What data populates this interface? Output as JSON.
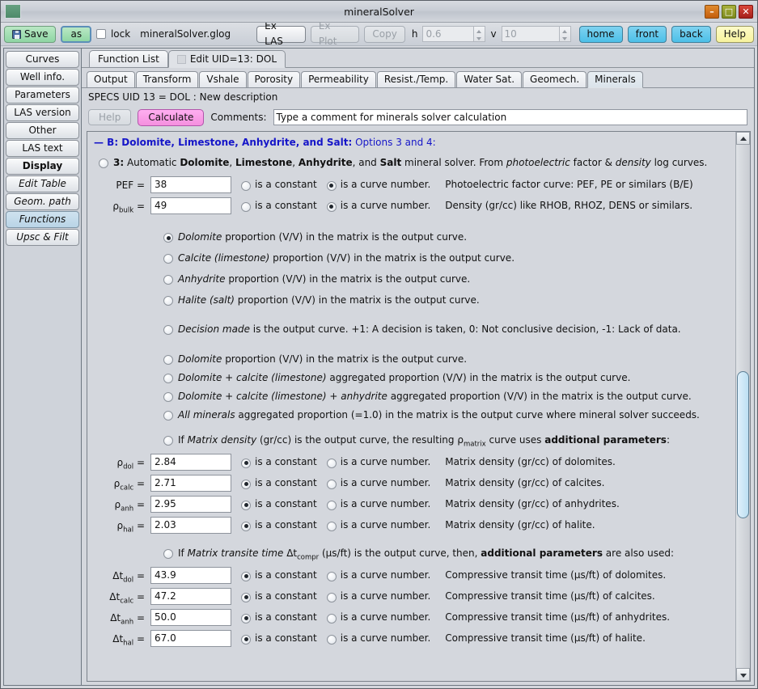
{
  "window": {
    "title": "mineralSolver",
    "icon": "app-icon",
    "buttons": {
      "minimize": "–",
      "maximize": "□",
      "close": "✕"
    }
  },
  "toolbar": {
    "save_label": "Save",
    "as_label": "as",
    "lock_label": "lock",
    "filename": "mineralSolver.glog",
    "ex_las_label": "Ex LAS",
    "ex_plot_label": "Ex Plot",
    "copy_label": "Copy",
    "h_label": "h",
    "h_value": "0.6",
    "v_label": "v",
    "v_value": "10",
    "home_label": "home",
    "front_label": "front",
    "back_label": "back",
    "help_label": "Help"
  },
  "sidebar": {
    "items": [
      {
        "label": "Curves",
        "style": "normal"
      },
      {
        "label": "Well info.",
        "style": "normal"
      },
      {
        "label": "Parameters",
        "style": "normal"
      },
      {
        "label": "LAS version",
        "style": "normal"
      },
      {
        "label": "Other",
        "style": "normal"
      },
      {
        "label": "LAS text",
        "style": "normal"
      },
      {
        "label": "Display",
        "style": "bold"
      },
      {
        "label": "Edit Table",
        "style": "italic"
      },
      {
        "label": "Geom. path",
        "style": "italic"
      },
      {
        "label": "Functions",
        "style": "italic-selected"
      },
      {
        "label": "Upsc & Filt",
        "style": "italic"
      }
    ]
  },
  "tabs_primary": [
    {
      "label": "Function List",
      "active": false
    },
    {
      "label": "Edit UID=13: DOL",
      "active": true
    }
  ],
  "tabs_secondary": [
    {
      "label": "Output",
      "active": false
    },
    {
      "label": "Transform",
      "active": false
    },
    {
      "label": "Vshale",
      "active": false
    },
    {
      "label": "Porosity",
      "active": false
    },
    {
      "label": "Permeability",
      "active": false
    },
    {
      "label": "Resist./Temp.",
      "active": false
    },
    {
      "label": "Water Sat.",
      "active": false
    },
    {
      "label": "Geomech.",
      "active": false
    },
    {
      "label": "Minerals",
      "active": true
    }
  ],
  "specs_line": "SPECS UID 13 = DOL : New description",
  "command_row": {
    "help_label": "Help",
    "calculate_label": "Calculate",
    "comments_label": "Comments:",
    "comments_value": "Type a comment for minerals solver calculation"
  },
  "section": {
    "heading_bold": "— B: Dolomite, Limestone, Anhydrite, and Salt:",
    "heading_thin": " Options 3 and 4:",
    "option3_selected": false,
    "option3_number": "3:",
    "option3_text_parts": [
      " Automatic ",
      "Dolomite",
      ", ",
      "Limestone",
      ", ",
      "Anhydrite",
      ", and ",
      "Salt",
      " mineral solver. From ",
      "photoelectric",
      " factor & ",
      "density",
      " log curves."
    ]
  },
  "inputs_top": [
    {
      "label": "PEF =",
      "value": "38",
      "constant_label": "is a constant",
      "constant_selected": false,
      "curve_label": "is a curve number.",
      "curve_selected": true,
      "description": "Photoelectric factor curve: PEF, PE or similars (B/E)"
    },
    {
      "label": "ρbulk =",
      "label_base": "ρ",
      "label_sub": "bulk",
      "value": "49",
      "constant_label": "is a constant",
      "constant_selected": false,
      "curve_label": "is a curve number.",
      "curve_selected": true,
      "description": "Density (gr/cc) like RHOB, RHOZ, DENS or similars."
    }
  ],
  "output_options": [
    {
      "selected": true,
      "italic": "Dolomite",
      "rest": " proportion (V/V) in the matrix is the output curve."
    },
    {
      "selected": false,
      "italic": "Calcite (limestone)",
      "rest": " proportion (V/V) in the matrix is the output curve."
    },
    {
      "selected": false,
      "italic": "Anhydrite",
      "rest": " proportion (V/V) in the matrix is the output curve."
    },
    {
      "selected": false,
      "italic": "Halite (salt)",
      "rest": " proportion (V/V) in the matrix is the output curve."
    }
  ],
  "decision_option": {
    "selected": false,
    "italic": "Decision made",
    "rest": " is the output curve. +1: A decision is taken, 0: Not conclusive decision, -1: Lack of data."
  },
  "aggregate_options": [
    {
      "selected": false,
      "italic": "Dolomite",
      "rest": " proportion (V/V) in the matrix is the output curve."
    },
    {
      "selected": false,
      "italic": "Dolomite + calcite (limestone)",
      "rest": " aggregated proportion (V/V) in the matrix is the output curve."
    },
    {
      "selected": false,
      "italic": "Dolomite + calcite (limestone) + anhydrite",
      "rest": " aggregated proportion (V/V) in the matrix is the output curve."
    },
    {
      "selected": false,
      "italic": "All minerals",
      "rest": " aggregated proportion (=1.0) in the matrix is the output curve where mineral solver succeeds."
    }
  ],
  "matrix_density_option": {
    "selected": false,
    "pre": "If ",
    "italic": "Matrix density",
    "mid": " (gr/cc) is the output curve, the resulting ρ",
    "sub": "matrix",
    "post": " curve uses ",
    "bold": "additional parameters",
    "tail": ":"
  },
  "density_params": [
    {
      "base": "ρ",
      "sub": "dol",
      "value": "2.84",
      "constant_label": "is a constant",
      "constant_selected": true,
      "curve_label": "is a curve number.",
      "curve_selected": false,
      "description": "Matrix density (gr/cc) of dolomites."
    },
    {
      "base": "ρ",
      "sub": "calc",
      "value": "2.71",
      "constant_label": "is a constant",
      "constant_selected": true,
      "curve_label": "is a curve number.",
      "curve_selected": false,
      "description": "Matrix density (gr/cc) of calcites."
    },
    {
      "base": "ρ",
      "sub": "anh",
      "value": "2.95",
      "constant_label": "is a constant",
      "constant_selected": true,
      "curve_label": "is a curve number.",
      "curve_selected": false,
      "description": "Matrix density (gr/cc) of anhydrites."
    },
    {
      "base": "ρ",
      "sub": "hal",
      "value": "2.03",
      "constant_label": "is a constant",
      "constant_selected": true,
      "curve_label": "is a curve number.",
      "curve_selected": false,
      "description": "Matrix density (gr/cc) of halite."
    }
  ],
  "transit_option": {
    "selected": false,
    "pre": "If ",
    "italic": "Matrix transite time",
    "mid": " Δt",
    "sub": "compr",
    "post": " (µs/ft) is the output curve, then, ",
    "bold": "additional parameters",
    "tail": " are also used:"
  },
  "transit_params": [
    {
      "base": "Δt",
      "sub": "dol",
      "value": "43.9",
      "constant_label": "is a constant",
      "constant_selected": true,
      "curve_label": "is a curve number.",
      "curve_selected": false,
      "description": "Compressive transit time (µs/ft) of dolomites."
    },
    {
      "base": "Δt",
      "sub": "calc",
      "value": "47.2",
      "constant_label": "is a constant",
      "constant_selected": true,
      "curve_label": "is a curve number.",
      "curve_selected": false,
      "description": "Compressive transit time (µs/ft) of calcites."
    },
    {
      "base": "Δt",
      "sub": "anh",
      "value": "50.0",
      "constant_label": "is a constant",
      "constant_selected": true,
      "curve_label": "is a curve number.",
      "curve_selected": false,
      "description": "Compressive transit time (µs/ft) of anhydrites."
    },
    {
      "base": "Δt",
      "sub": "hal",
      "value": "67.0",
      "constant_label": "is a constant",
      "constant_selected": true,
      "curve_label": "is a curve number.",
      "curve_selected": false,
      "description": "Compressive transit time (µs/ft) of halite."
    }
  ],
  "scrollbar": {
    "up_arrow": "▲",
    "down_arrow": "▼"
  },
  "colors": {
    "accent_blue": "#1515c8",
    "calculate_pink": "#ffaff0",
    "nav_blue": "#4cc0e8",
    "save_green": "#8fd6a4",
    "help_yellow": "#f7f39e"
  }
}
